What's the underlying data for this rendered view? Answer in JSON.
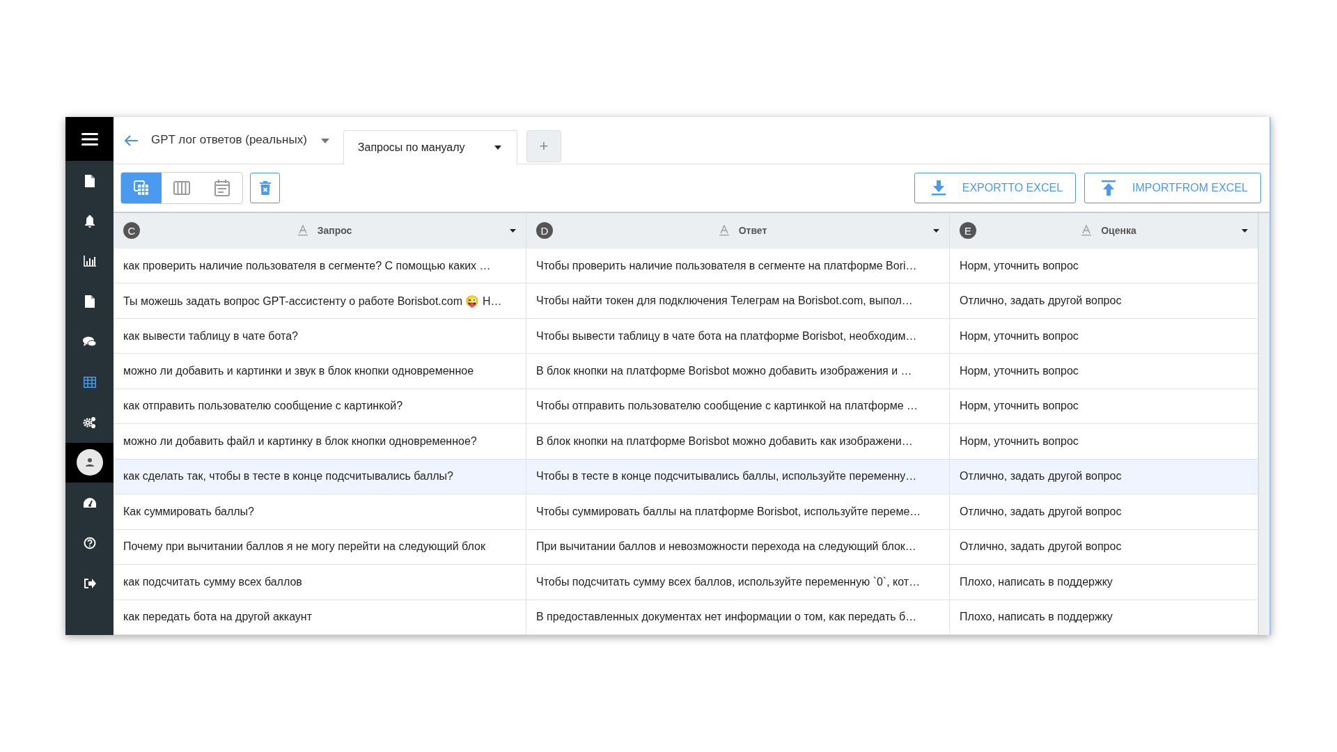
{
  "sidebar": {
    "items": [
      {
        "selected": false
      },
      {
        "selected": false
      },
      {
        "selected": false
      },
      {
        "selected": false
      },
      {
        "selected": false
      },
      {
        "selected": true
      },
      {
        "selected": false
      },
      {
        "selected": true
      },
      {
        "selected": false
      },
      {
        "selected": false
      },
      {
        "selected": false
      }
    ]
  },
  "header": {
    "title": "GPT лог ответов (реальных)",
    "tabs": [
      {
        "label": "Запросы по мануалу",
        "selected": true
      }
    ],
    "add_tab": "+"
  },
  "toolbar": {
    "views": [
      {
        "selected": true
      },
      {
        "selected": false
      },
      {
        "selected": false
      }
    ],
    "export_label": "EXPORTTO EXCEL",
    "import_label": "IMPORTFROM EXCEL"
  },
  "table": {
    "columns": [
      {
        "letter": "C",
        "name": "Запрос"
      },
      {
        "letter": "D",
        "name": "Ответ"
      },
      {
        "letter": "E",
        "name": "Оценка"
      }
    ],
    "rows": [
      {
        "selected": false,
        "cells": [
          "как проверить наличие пользователя в сегменте? С помощью каких …",
          "Чтобы проверить наличие пользователя в сегменте на платформе Bori…",
          "Норм, уточнить вопрос"
        ]
      },
      {
        "selected": false,
        "cells": [
          "Ты можешь задать вопрос GPT-ассистенту о работе Borisbot.com 😜 Н…",
          "Чтобы найти токен для подключения Телеграм на Borisbot.com, выпол…",
          "Отлично, задать другой вопрос"
        ]
      },
      {
        "selected": false,
        "cells": [
          "как вывести таблицу в чате бота?",
          "Чтобы вывести таблицу в чате бота на платформе Borisbot, необходим…",
          "Норм, уточнить вопрос"
        ]
      },
      {
        "selected": false,
        "cells": [
          "можно ли добавить и картинки и звук в блок кнопки одновременное",
          "В блок кнопки на платформе Borisbot можно добавить изображения и …",
          "Норм, уточнить вопрос"
        ]
      },
      {
        "selected": false,
        "cells": [
          "как отправить пользователю сообщение с картинкой?",
          "Чтобы отправить пользователю сообщение с картинкой на платформе …",
          "Норм, уточнить вопрос"
        ]
      },
      {
        "selected": false,
        "cells": [
          "можно ли добавить файл и картинку в блок кнопки одновременное?",
          "В блок кнопки на платформе Borisbot можно добавить как изображени…",
          "Норм, уточнить вопрос"
        ]
      },
      {
        "selected": true,
        "cells": [
          "как сделать так, чтобы в тесте в конце подсчитывались баллы?",
          "Чтобы в тесте в конце подсчитывались баллы, используйте переменну…",
          "Отлично, задать другой вопрос"
        ]
      },
      {
        "selected": false,
        "cells": [
          "Как суммировать баллы?",
          "Чтобы суммировать баллы на платформе Borisbot, используйте переме…",
          "Отлично, задать другой вопрос"
        ]
      },
      {
        "selected": false,
        "cells": [
          "Почему при вычитании баллов я не могу перейти на следующий блок",
          "При вычитании баллов и невозможности перехода на следующий блок…",
          "Отлично, задать другой вопрос"
        ]
      },
      {
        "selected": false,
        "cells": [
          "как подсчитать сумму всех баллов",
          "Чтобы подсчитать сумму всех баллов, используйте переменную `0`, кот…",
          "Плохо, написать в поддержку"
        ]
      },
      {
        "selected": false,
        "cells": [
          "как передать бота на другой аккаунт",
          "В предоставленных документах нет информации о том, как передать б…",
          "Плохо, написать в поддержку"
        ]
      }
    ]
  }
}
